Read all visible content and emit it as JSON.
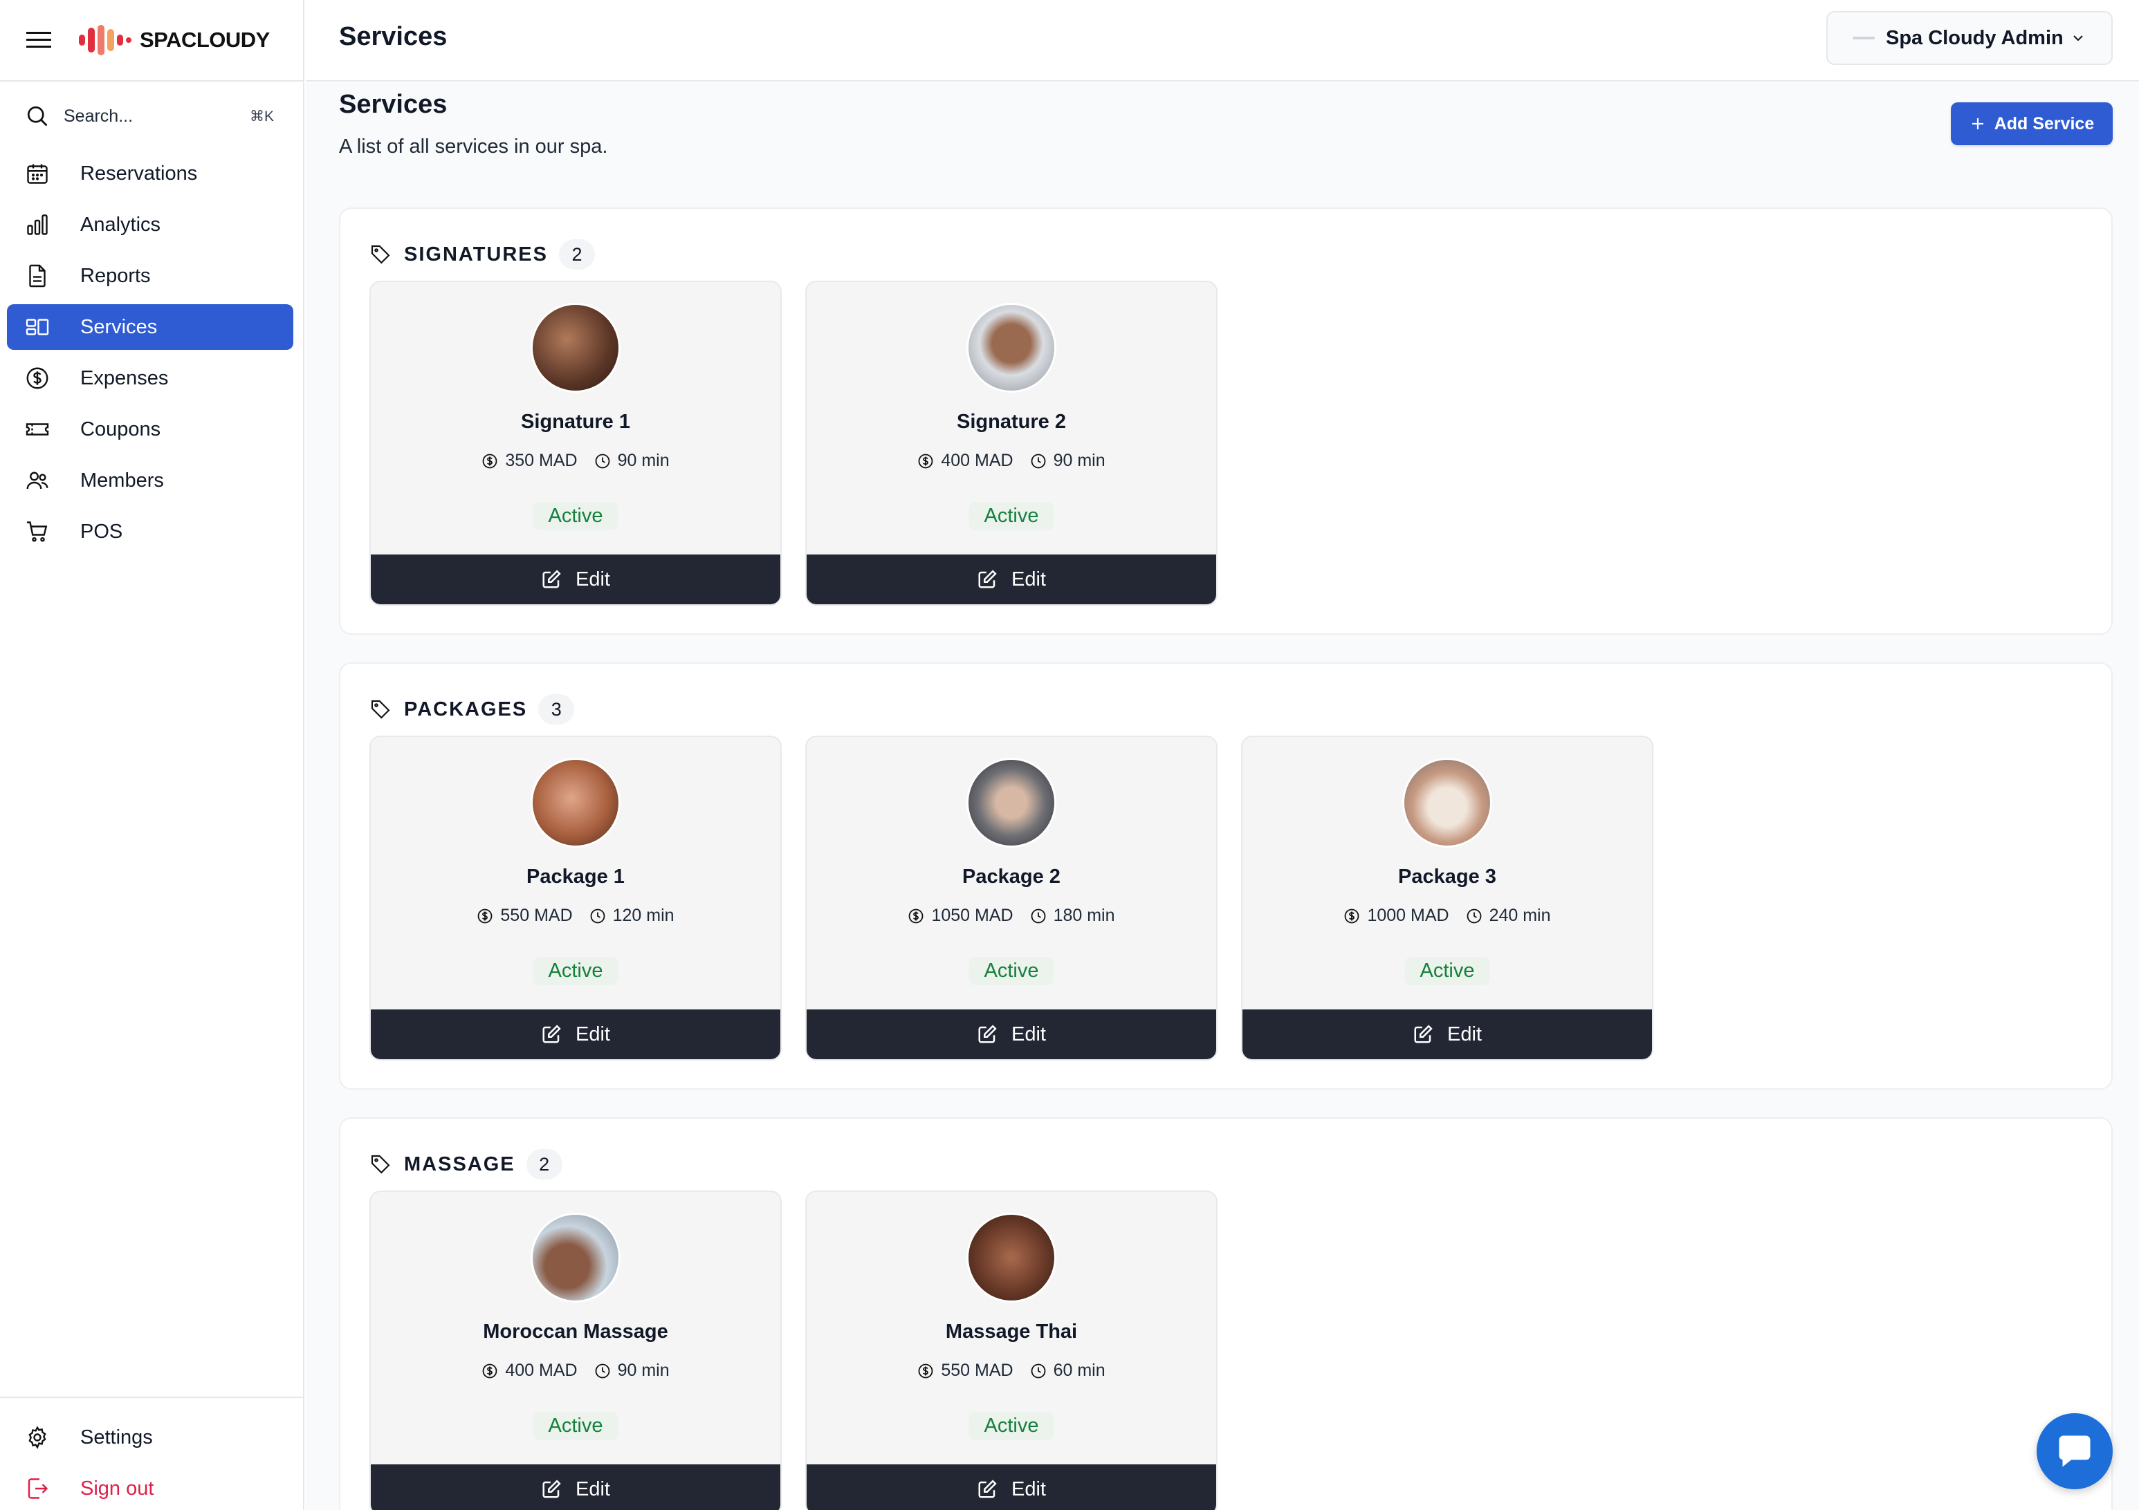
{
  "app": {
    "logo_text": "SPACLOUDY",
    "accent": "#2f5bd3",
    "sidebar_active_bg": "#2f5bd3",
    "edit_button_bg": "#232734",
    "status_color": "#15803d",
    "signout_color": "#e11d48"
  },
  "search": {
    "placeholder": "Search...",
    "shortcut": "⌘K"
  },
  "sidebar": {
    "items": [
      {
        "label": "Reservations",
        "icon": "calendar-icon"
      },
      {
        "label": "Analytics",
        "icon": "bar-chart-icon"
      },
      {
        "label": "Reports",
        "icon": "document-icon"
      },
      {
        "label": "Services",
        "icon": "layout-icon",
        "active": true
      },
      {
        "label": "Expenses",
        "icon": "dollar-circle-icon"
      },
      {
        "label": "Coupons",
        "icon": "ticket-icon"
      },
      {
        "label": "Members",
        "icon": "users-icon"
      },
      {
        "label": "POS",
        "icon": "cart-icon"
      }
    ],
    "bottom": [
      {
        "label": "Settings",
        "icon": "gear-icon"
      },
      {
        "label": "Sign out",
        "icon": "sign-out-icon"
      }
    ]
  },
  "topbar": {
    "title": "Services",
    "admin_name": "Spa Cloudy Admin"
  },
  "page": {
    "title": "Services",
    "subtitle": "A list of all services in our spa.",
    "add_button": "Add Service"
  },
  "sections": [
    {
      "title": "SIGNATURES",
      "count": "2",
      "cards": [
        {
          "name": "Signature 1",
          "price": "350 MAD",
          "duration": "90 min",
          "status": "Active",
          "edit": "Edit"
        },
        {
          "name": "Signature 2",
          "price": "400 MAD",
          "duration": "90 min",
          "status": "Active",
          "edit": "Edit"
        }
      ]
    },
    {
      "title": "PACKAGES",
      "count": "3",
      "cards": [
        {
          "name": "Package 1",
          "price": "550 MAD",
          "duration": "120 min",
          "status": "Active",
          "edit": "Edit"
        },
        {
          "name": "Package 2",
          "price": "1050 MAD",
          "duration": "180 min",
          "status": "Active",
          "edit": "Edit"
        },
        {
          "name": "Package 3",
          "price": "1000 MAD",
          "duration": "240 min",
          "status": "Active",
          "edit": "Edit"
        }
      ]
    },
    {
      "title": "MASSAGE",
      "count": "2",
      "cards": [
        {
          "name": "Moroccan Massage",
          "price": "400 MAD",
          "duration": "90 min",
          "status": "Active",
          "edit": "Edit"
        },
        {
          "name": "Massage Thai",
          "price": "550 MAD",
          "duration": "60 min",
          "status": "Active",
          "edit": "Edit"
        }
      ]
    }
  ]
}
